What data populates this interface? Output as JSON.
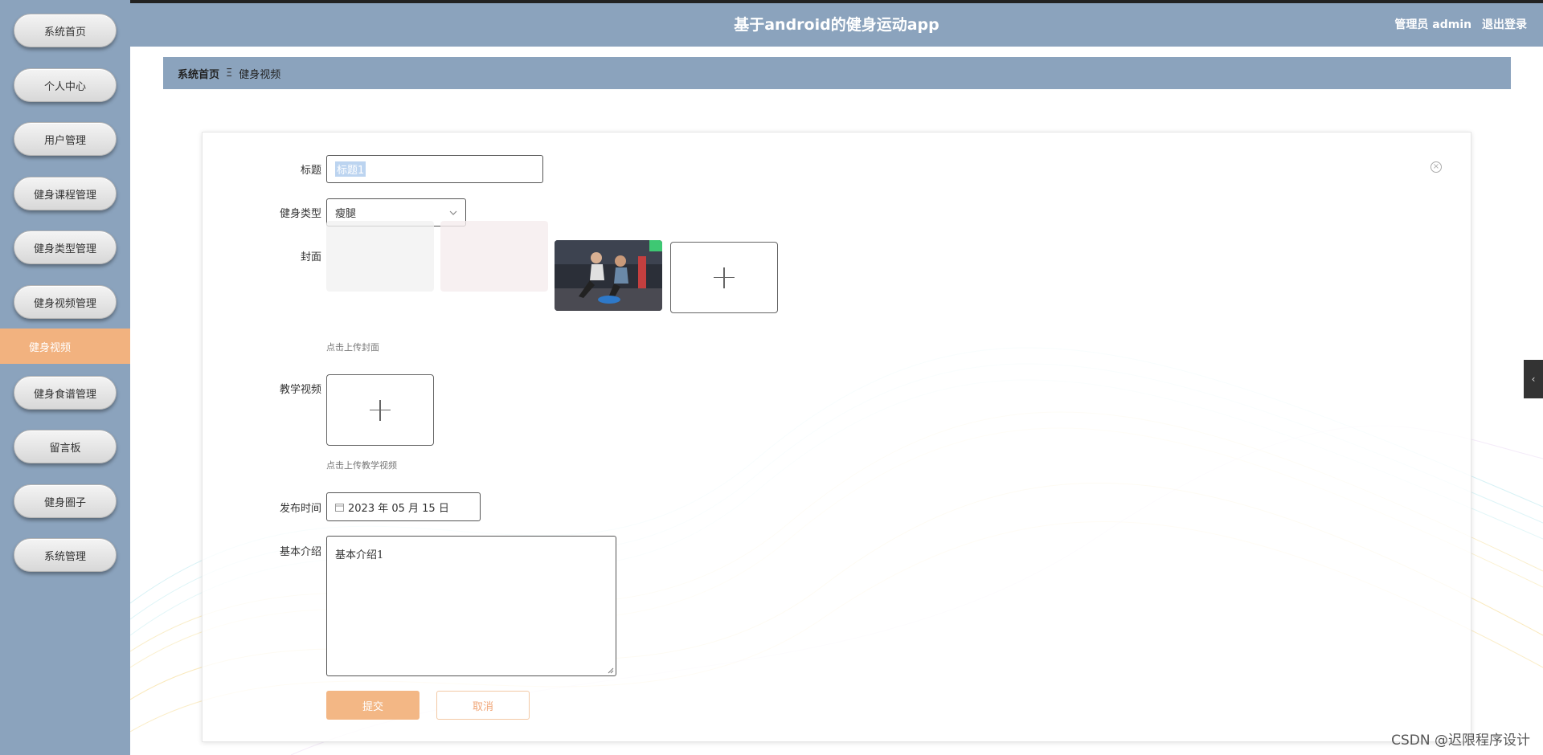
{
  "header": {
    "title": "基于android的健身运动app",
    "user_label": "管理员 admin",
    "logout_label": "退出登录"
  },
  "sidebar": {
    "items": [
      {
        "label": "系统首页"
      },
      {
        "label": "个人中心"
      },
      {
        "label": "用户管理"
      },
      {
        "label": "健身课程管理"
      },
      {
        "label": "健身类型管理"
      },
      {
        "label": "健身视频管理"
      },
      {
        "label": "健身视频",
        "active": true
      },
      {
        "label": "健身食谱管理"
      },
      {
        "label": "留言板"
      },
      {
        "label": "健身圈子"
      },
      {
        "label": "系统管理"
      }
    ]
  },
  "breadcrumb": {
    "home": "系统首页",
    "separator": "Ξ",
    "current": "健身视频"
  },
  "form": {
    "title_label": "标题",
    "title_value": "标题1",
    "type_label": "健身类型",
    "type_value": "瘦腿",
    "cover_label": "封面",
    "cover_hint": "点击上传封面",
    "video_label": "教学视频",
    "video_hint": "点击上传教学视频",
    "date_label": "发布时间",
    "date_value": "2023 年 05 月 15 日",
    "intro_label": "基本介绍",
    "intro_value": "基本介绍1",
    "submit_label": "提交",
    "cancel_label": "取消"
  },
  "colors": {
    "sidebar_bg": "#8ba3bd",
    "active_item": "#f2b27f",
    "submit_button": "#f3b785"
  },
  "watermark": "CSDN @迟限程序设计"
}
